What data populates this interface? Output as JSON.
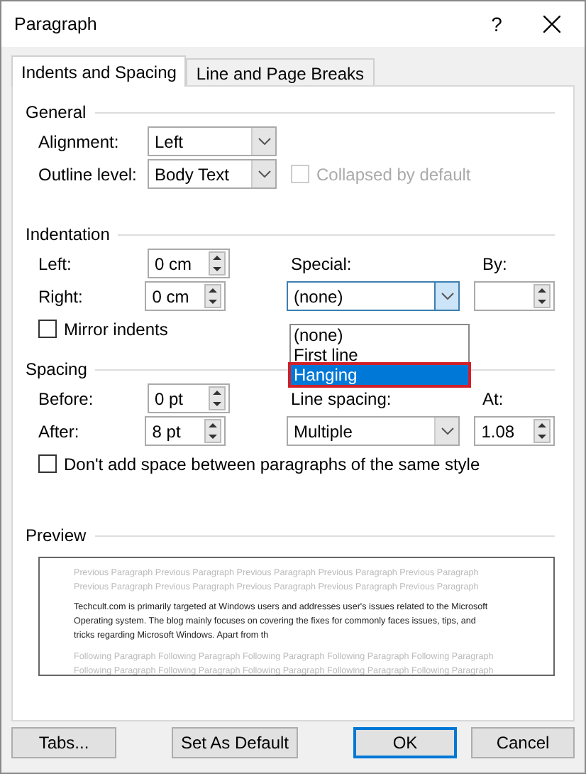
{
  "window": {
    "title": "Paragraph",
    "help": "?"
  },
  "tabs": [
    {
      "label": "Indents and Spacing",
      "selected": true
    },
    {
      "label": "Line and Page Breaks",
      "selected": false
    }
  ],
  "general": {
    "heading": "General",
    "alignment": {
      "label": "Alignment:",
      "value": "Left"
    },
    "outline_level": {
      "label": "Outline level:",
      "value": "Body Text"
    },
    "collapsed": {
      "label": "Collapsed by default",
      "checked": false,
      "disabled": true
    }
  },
  "indentation": {
    "heading": "Indentation",
    "left": {
      "label": "Left:",
      "value": "0 cm"
    },
    "right": {
      "label": "Right:",
      "value": "0 cm"
    },
    "special": {
      "label": "Special:",
      "value": "(none)",
      "expanded": true,
      "options": [
        {
          "label": "(none)",
          "highlighted": false,
          "marked": false
        },
        {
          "label": "First line",
          "highlighted": false,
          "marked": false
        },
        {
          "label": "Hanging",
          "highlighted": true,
          "marked": true
        }
      ]
    },
    "by": {
      "label": "By:"
    },
    "mirror": {
      "label": "Mirror indents",
      "checked": false
    }
  },
  "spacing": {
    "heading": "Spacing",
    "before": {
      "label": "Before:",
      "value": "0 pt"
    },
    "after": {
      "label": "After:",
      "value": "8 pt"
    },
    "line_spacing": {
      "label": "Line spacing:",
      "value": "Multiple"
    },
    "at": {
      "label": "At:",
      "value": "1.08"
    },
    "dont_add": {
      "label": "Don't add space between paragraphs of the same style",
      "checked": false
    }
  },
  "preview": {
    "heading": "Preview",
    "previous": [
      "Previous Paragraph Previous Paragraph Previous Paragraph Previous Paragraph Previous Paragraph",
      "Previous Paragraph Previous Paragraph Previous Paragraph Previous Paragraph Previous Paragraph"
    ],
    "text": [
      "Techcult.com is primarily targeted at Windows users and addresses user's issues related to the Microsoft",
      "Operating system. The blog mainly focuses on covering the fixes for commonly faces issues, tips, and",
      "tricks regarding Microsoft Windows. Apart from th"
    ],
    "following": [
      "Following Paragraph Following Paragraph Following Paragraph Following Paragraph Following Paragraph",
      "Following Paragraph Following Paragraph Following Paragraph Following Paragraph Following Paragraph"
    ]
  },
  "buttons": [
    {
      "label": "Tabs...",
      "default": false
    },
    {
      "label": "Set As Default",
      "default": false
    },
    {
      "label": "OK",
      "default": true
    },
    {
      "label": "Cancel",
      "default": false
    }
  ]
}
